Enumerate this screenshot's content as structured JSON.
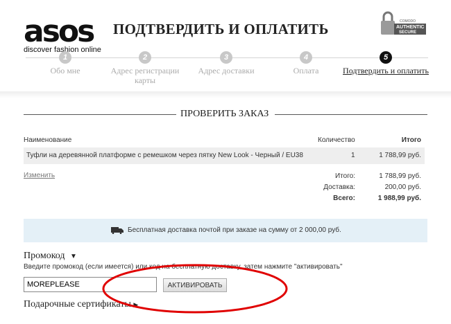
{
  "brand": {
    "name": "asos",
    "tagline": "discover fashion online"
  },
  "page_title": "ПОДТВЕРДИТЬ И ОПЛАТИТЬ",
  "security_badge": {
    "lines": [
      "COMODO",
      "AUTHENTIC",
      "SECURE"
    ]
  },
  "steps": [
    {
      "num": "1",
      "label": "Обо мне"
    },
    {
      "num": "2",
      "label": "Адрес регистрации карты"
    },
    {
      "num": "3",
      "label": "Адрес доставки"
    },
    {
      "num": "4",
      "label": "Оплата"
    },
    {
      "num": "5",
      "label": "Подтвердить и оплатить"
    }
  ],
  "review": {
    "title": "ПРОВЕРИТЬ ЗАКАЗ",
    "columns": {
      "name": "Наименование",
      "qty": "Количество",
      "total": "Итого"
    },
    "items": [
      {
        "name": "Туфли на деревянной платформе с ремешком через пятку New Look - Черный / EU38",
        "qty": "1",
        "total": "1 788,99 руб."
      }
    ],
    "edit_link": "Изменить",
    "summary": {
      "subtotal_label": "Итого:",
      "subtotal": "1 788,99 руб.",
      "delivery_label": "Доставка:",
      "delivery": "200,00 руб.",
      "grand_label": "Всего:",
      "grand": "1 988,99 руб."
    }
  },
  "shipping_banner": "Бесплатная доставка почтой при заказе на сумму от 2 000,00 руб.",
  "promo": {
    "title": "Промокод",
    "help": "Введите промокод (если имеется) или код на бесплатную доставку, затем нажмите \"активировать\"",
    "value": "MOREPLEASE",
    "button": "АКТИВИРОВАТЬ"
  },
  "gift_title": "Подарочные сертификаты",
  "colors": {
    "annotation": "#e00000",
    "banner_bg": "#e4f0f7",
    "active_step": "#111111"
  }
}
